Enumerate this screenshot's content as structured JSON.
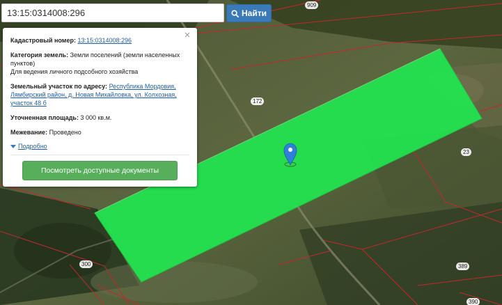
{
  "search": {
    "value": "13:15:0314008:296",
    "button_label": "Найти"
  },
  "popup": {
    "cadastral_label": "Кадастровый номер:",
    "cadastral_value": "13:15:0314008:296",
    "category_label": "Категория земель:",
    "category_value": "Земли поселений (земли населенных пунктов)",
    "use_value": "Для ведения личного подсобного хозяйства",
    "address_label": "Земельный участок по адресу:",
    "address_value": "Республика Мордовия, Лямбирский район, д. Новая Михайловка, ул. Колхозная, участок 48 б",
    "area_label": "Уточненная площадь:",
    "area_value": "3 000 кв.м.",
    "survey_label": "Межевание:",
    "survey_value": "Проведено",
    "more_label": "Подробно",
    "docs_button": "Посмотреть доступные документы"
  },
  "map": {
    "plot_numbers": [
      "909",
      "172",
      "23",
      "300",
      "389",
      "390"
    ],
    "highlight_color": "#22e34f",
    "boundary_color": "#c0292b",
    "marker_color": "#2f80d8"
  }
}
